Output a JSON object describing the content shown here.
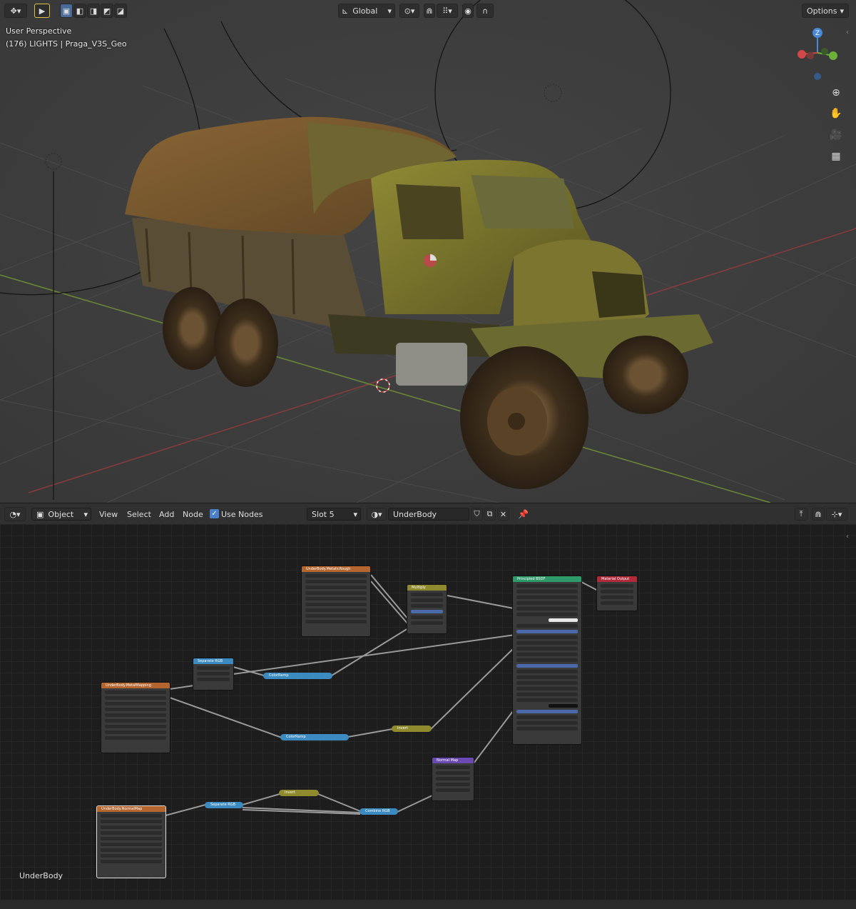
{
  "viewport": {
    "header": {
      "transform_orientation": "Global",
      "options_label": "Options"
    },
    "overlay": {
      "view_name": "User Perspective",
      "object_info": "(176) LIGHTS | Praga_V3S_Geo"
    },
    "gizmo_axis_label": "Z"
  },
  "node_editor": {
    "header": {
      "mode": "Object",
      "menus": [
        "View",
        "Select",
        "Add",
        "Node"
      ],
      "use_nodes_label": "Use Nodes",
      "slot": "Slot 5",
      "material_name": "UnderBody"
    },
    "material_label": "UnderBody",
    "nodes": {
      "base_color_tex": "UnderBody.MetalicRough",
      "metal_tex": "UnderBody.MetalMapping",
      "normal_tex": "UnderBody.NormalMap",
      "mix": "Multiply",
      "separate": "Separate RGB",
      "bsdf": "Principled BSDF",
      "output": "Material Output",
      "normal_map": "Normal Map"
    },
    "reroutes": {
      "color_ramp": "ColorRamp",
      "color_ramp_2": "ColorRamp",
      "invert": "Invert",
      "invert_2": "Invert",
      "separate_rgb": "Separate RGB",
      "combine_rgb": "Combine RGB"
    }
  }
}
